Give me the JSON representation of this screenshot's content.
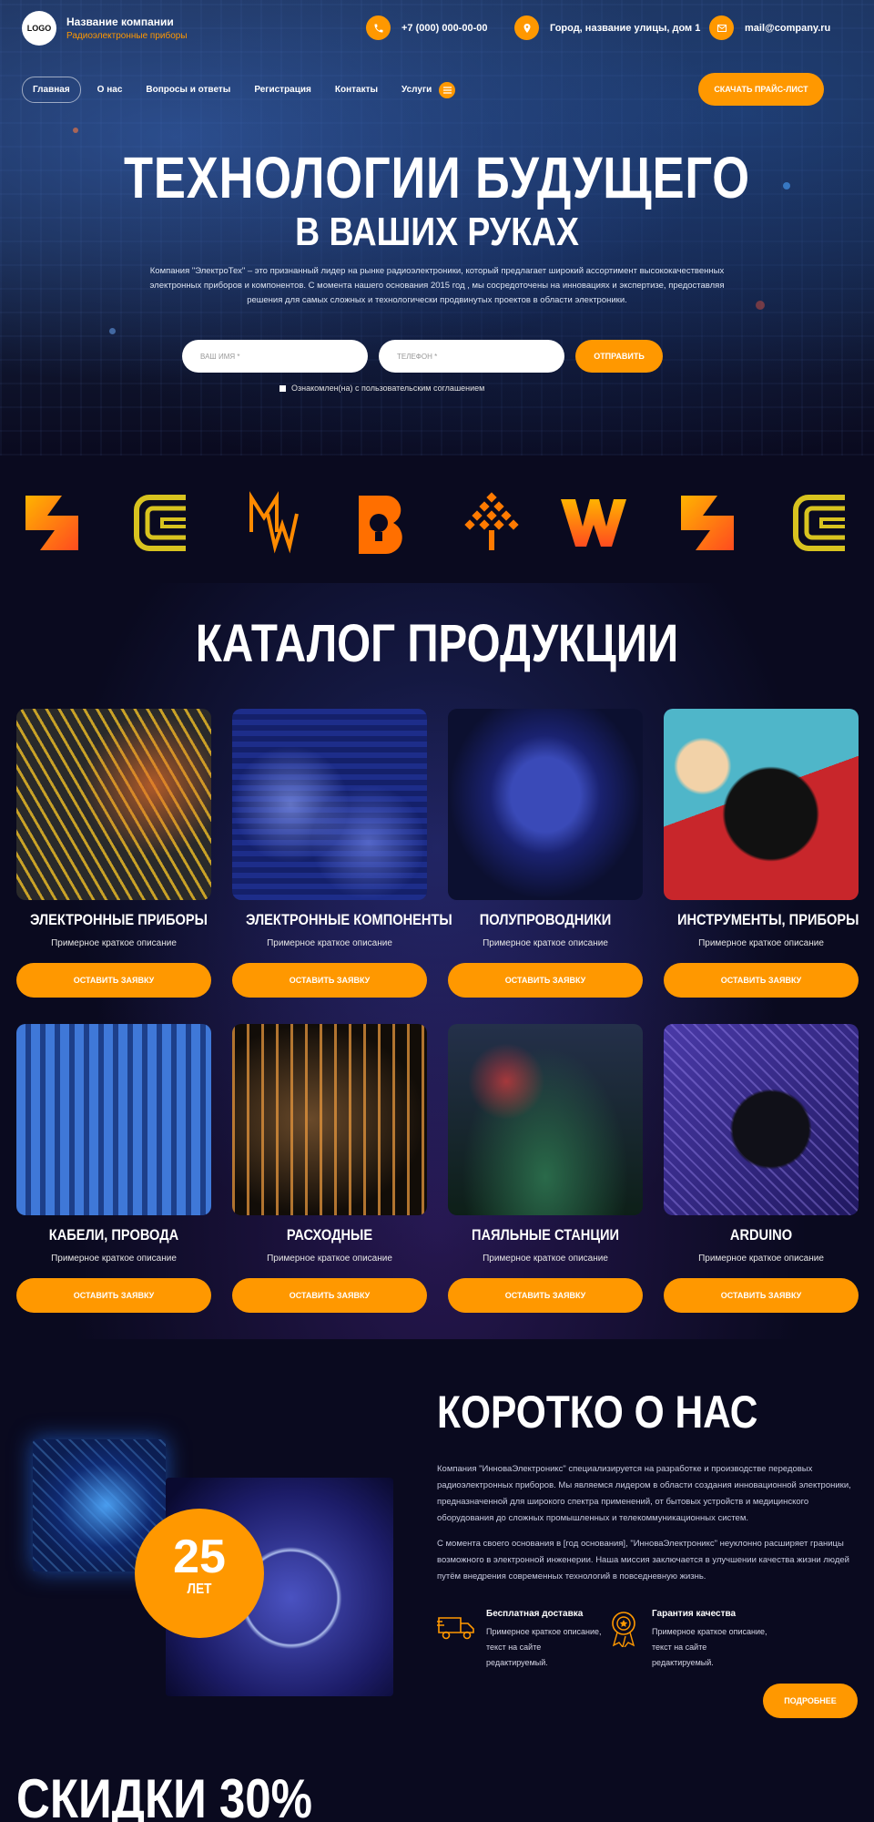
{
  "header": {
    "logo": "LOGO",
    "company_name": "Название компании",
    "company_sub": "Радиоэлектронные приборы",
    "phone": "+7 (000) 000-00-00",
    "address": "Город, название улицы, дом 1",
    "email": "mail@company.ru",
    "price_button": "СКАЧАТЬ ПРАЙС-ЛИСТ"
  },
  "nav": {
    "items": [
      "Главная",
      "О нас",
      "Вопросы и ответы",
      "Регистрация",
      "Контакты",
      "Услуги"
    ]
  },
  "hero": {
    "title_line1": "ТЕХНОЛОГИИ БУДУЩЕГО",
    "title_line2": "В ВАШИХ РУКАХ",
    "description": "Компания \"ЭлектроТех\" – это признанный лидер на рынке радиоэлектроники, который предлагает широкий ассортимент высококачественных электронных приборов и компонентов. С момента нашего основания 2015 год , мы сосредоточены на инновациях и экспертизе, предоставляя решения для самых сложных и технологически продвинутых проектов в области электроники.",
    "name_placeholder": "ВАШ ИМЯ *",
    "phone_placeholder": "ТЕЛЕФОН *",
    "send_button": "ОТПРАВИТЬ",
    "consent": "Ознакомлен(на) с пользовательским соглашением"
  },
  "catalog": {
    "title": "КАТАЛОГ ПРОДУКЦИИ",
    "desc": "Примерное краткое описание",
    "button": "ОСТАВИТЬ ЗАЯВКУ",
    "items": [
      "ЭЛЕКТРОННЫЕ ПРИБОРЫ",
      "ЭЛЕКТРОННЫЕ КОМПОНЕНТЫ",
      "ПОЛУПРОВОДНИКИ",
      "ИНСТРУМЕНТЫ, ПРИБОРЫ",
      "КАБЕЛИ, ПРОВОДА",
      "РАСХОДНЫЕ",
      "ПАЯЛЬНЫЕ СТАНЦИИ",
      "ARDUINO"
    ]
  },
  "about": {
    "title": "КОРОТКО О НАС",
    "p1": "Компания \"ИнноваЭлектроникс\" специализируется на разработке и производстве передовых радиоэлектронных приборов. Мы являемся лидером в области создания инновационной электроники, предназначенной для широкого спектра применений, от бытовых устройств и медицинского оборудования до сложных промышленных и телекоммуникационных систем.",
    "p2": "С момента своего основания в [год основания], \"ИнноваЭлектроникс\" неуклонно расширяет границы возможного в электронной инженерии. Наша миссия заключается в улучшении качества жизни людей путём внедрения современных технологий в повседневную жизнь.",
    "years_num": "25",
    "years_label": "ЛЕТ",
    "feature1_title": "Бесплатная доставка",
    "feature1_desc": "Примерное краткое описание, текст на сайте редактируемый.",
    "feature2_title": "Гарантия качества",
    "feature2_desc": "Примерное краткое описание, текст на сайте редактируемый.",
    "more_button": "ПОДРОБНЕЕ"
  },
  "discount": {
    "title": "СКИДКИ 30%"
  },
  "colors": {
    "accent": "#ff9800",
    "background": "#0a0a1f"
  }
}
